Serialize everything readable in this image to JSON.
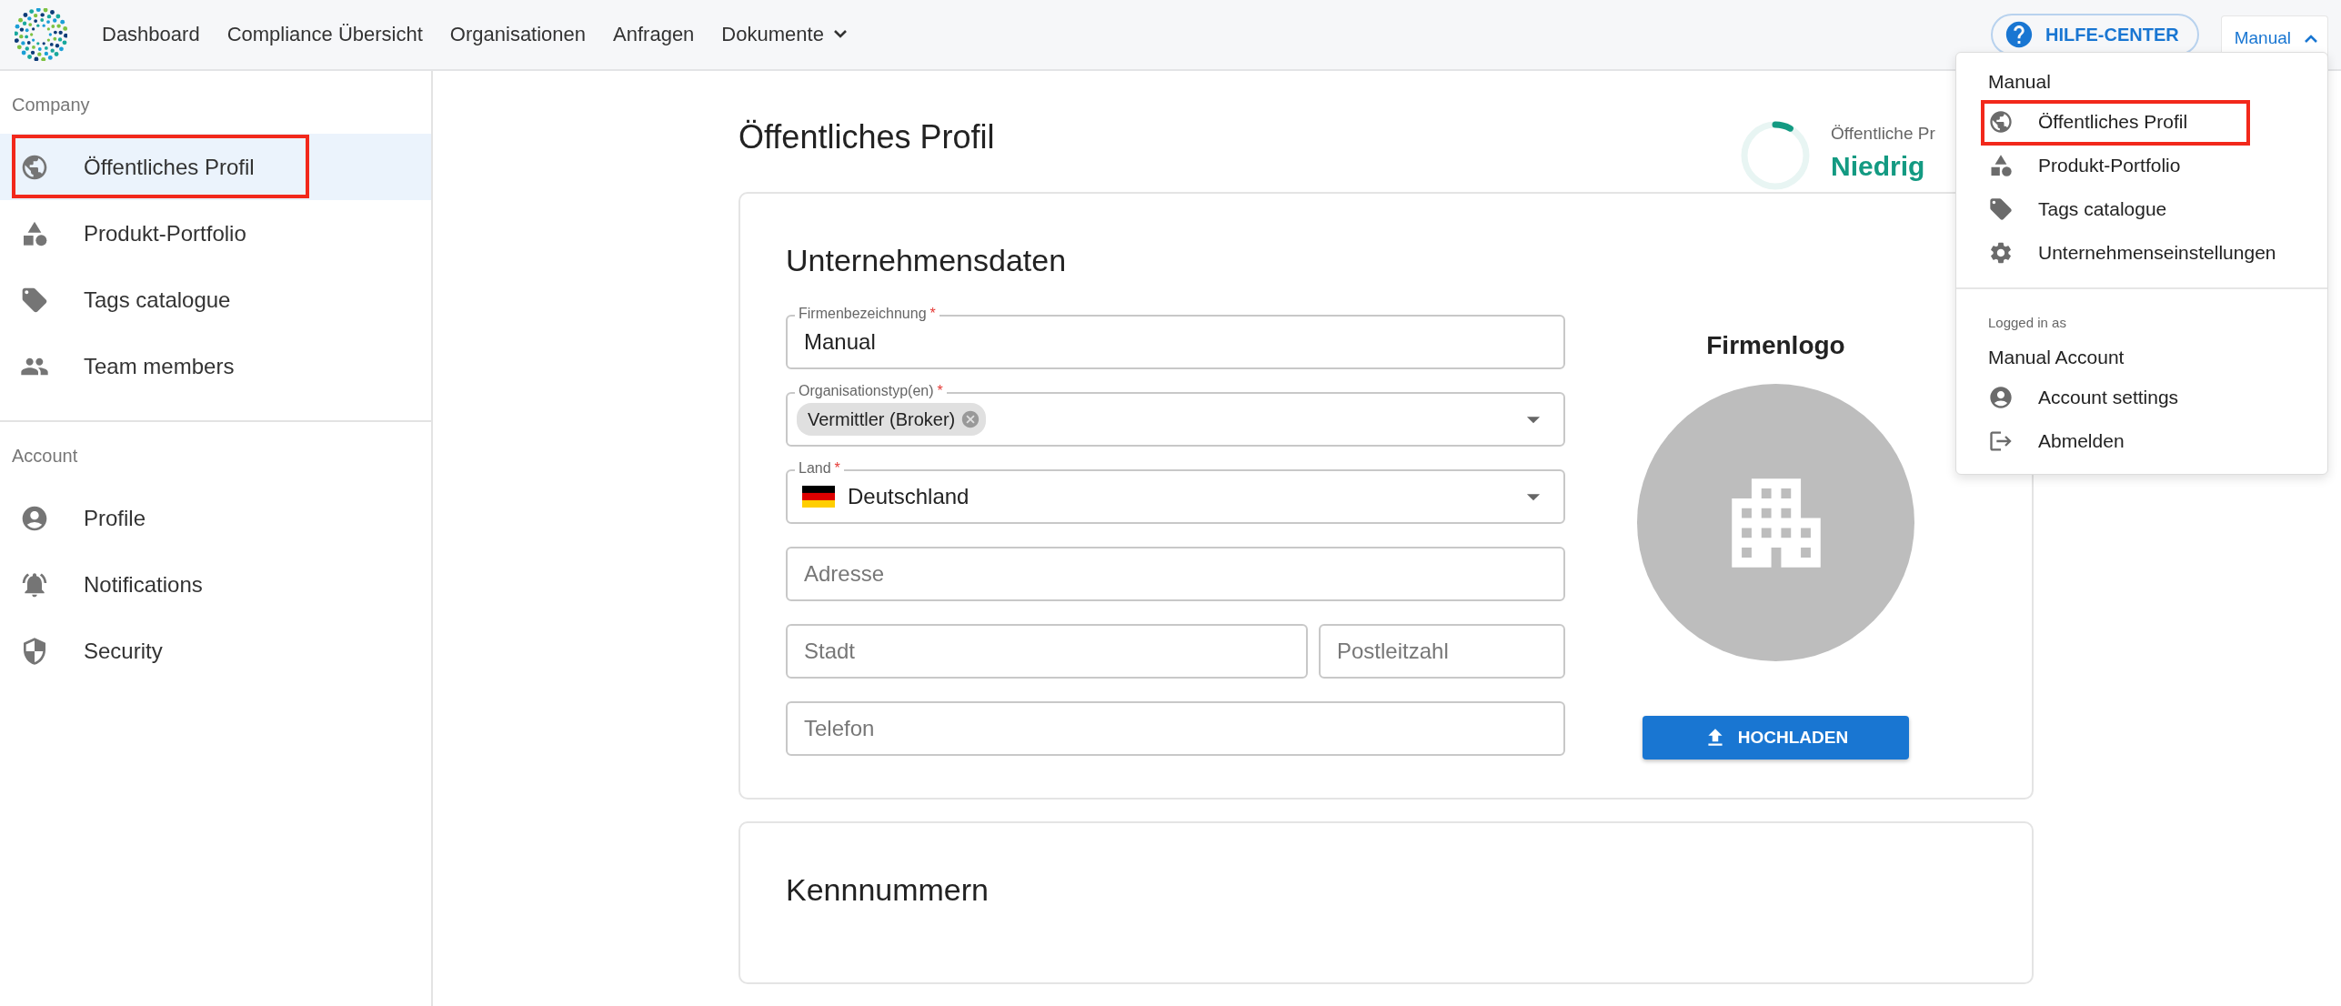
{
  "nav": {
    "items": [
      {
        "label": "Dashboard",
        "kind": "link"
      },
      {
        "label": "Compliance Übersicht",
        "kind": "link"
      },
      {
        "label": "Organisationen",
        "kind": "link"
      },
      {
        "label": "Anfragen",
        "kind": "link"
      },
      {
        "label": "Dokumente",
        "kind": "dropdown"
      }
    ]
  },
  "help_button": {
    "label": "HILFE-CENTER"
  },
  "account_button": {
    "label": "Manual",
    "expanded": true
  },
  "sidebar": {
    "sections": [
      {
        "title": "Company",
        "items": [
          {
            "label": "Öffentliches Profil",
            "selected": true,
            "highlighted": true
          },
          {
            "label": "Produkt-Portfolio",
            "selected": false,
            "highlighted": false
          },
          {
            "label": "Tags catalogue",
            "selected": false,
            "highlighted": false
          },
          {
            "label": "Team members",
            "selected": false,
            "highlighted": false
          }
        ]
      },
      {
        "title": "Account",
        "items": [
          {
            "label": "Profile",
            "selected": false,
            "highlighted": false
          },
          {
            "label": "Notifications",
            "selected": false,
            "highlighted": false
          },
          {
            "label": "Security",
            "selected": false,
            "highlighted": false
          }
        ]
      }
    ]
  },
  "page": {
    "title": "Öffentliches Profil",
    "profile_score": {
      "label": "Öffentliche Pr",
      "level": 0.08,
      "value": "Niedrig"
    }
  },
  "company_card": {
    "title": "Unternehmensdaten",
    "rows": [
      [
        {
          "kind": "text",
          "label": "Firmenbezeichnung",
          "required_mark": "*",
          "value": "Manual"
        }
      ],
      [
        {
          "kind": "chips",
          "label": "Organisationstyp(en)",
          "required_mark": "*",
          "chips": [
            "Vermittler (Broker)"
          ]
        }
      ],
      [
        {
          "kind": "country",
          "label": "Land",
          "required_mark": "*",
          "value": "Deutschland"
        }
      ],
      [
        {
          "kind": "text",
          "placeholder": "Adresse"
        }
      ],
      [
        {
          "kind": "text",
          "placeholder": "Stadt"
        },
        {
          "kind": "text",
          "placeholder": "Postleitzahl"
        }
      ],
      [
        {
          "kind": "text",
          "placeholder": "Telefon"
        }
      ]
    ],
    "logo": {
      "title": "Firmenlogo",
      "button": "HOCHLADEN"
    }
  },
  "ids_card": {
    "title": "Kennnummern"
  },
  "account_menu": {
    "org_name": "Manual",
    "company_items": [
      {
        "label": "Öffentliches Profil",
        "highlighted": true
      },
      {
        "label": "Produkt-Portfolio",
        "highlighted": false
      },
      {
        "label": "Tags catalogue",
        "highlighted": false
      },
      {
        "label": "Unternehmenseinstellungen",
        "highlighted": false
      }
    ],
    "logged_in_label": "Logged in as",
    "account_name": "Manual Account",
    "account_items": [
      {
        "label": "Account settings"
      },
      {
        "label": "Abmelden"
      }
    ]
  }
}
